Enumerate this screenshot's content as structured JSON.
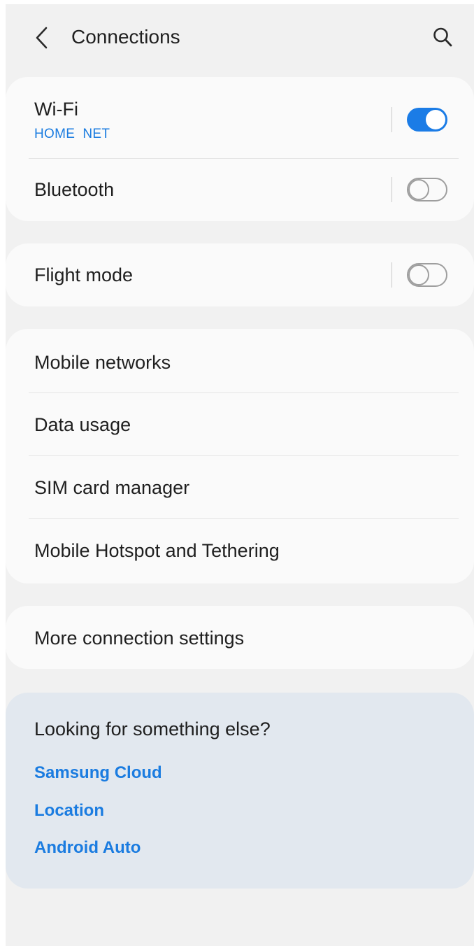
{
  "header": {
    "title": "Connections",
    "back_icon": "chevron-left-icon",
    "search_icon": "search-icon"
  },
  "card_1": {
    "wifi": {
      "label": "Wi-Fi",
      "network": "HOME  NET",
      "toggle_on": true
    },
    "bluetooth": {
      "label": "Bluetooth",
      "toggle_on": false
    }
  },
  "card_2": {
    "flight_mode": {
      "label": "Flight mode",
      "toggle_on": false
    }
  },
  "card_3": {
    "items": [
      {
        "label": "Mobile networks"
      },
      {
        "label": "Data usage"
      },
      {
        "label": "SIM card manager"
      },
      {
        "label": "Mobile Hotspot and Tethering"
      }
    ]
  },
  "card_4": {
    "more_settings": {
      "label": "More connection settings"
    }
  },
  "suggestions": {
    "title": "Looking for something else?",
    "links": [
      "Samsung Cloud",
      "Location",
      "Android Auto"
    ]
  },
  "colors": {
    "accent": "#1b7ce0",
    "background": "#f1f1f1",
    "card": "#fafafa",
    "suggestion_panel": "#e2e8ef"
  }
}
